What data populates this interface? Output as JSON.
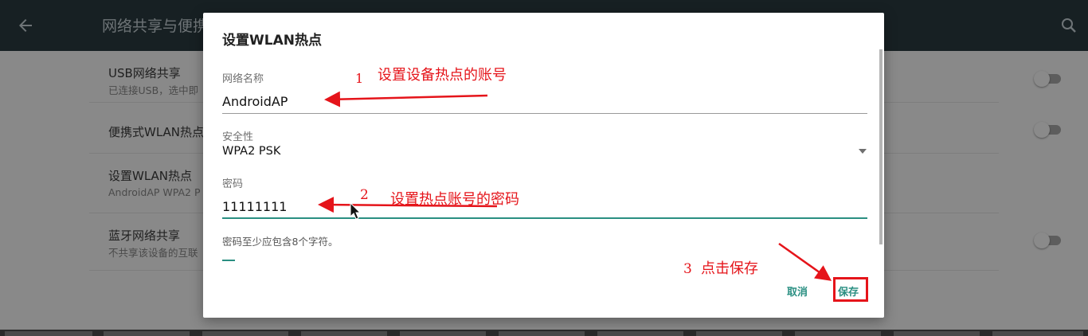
{
  "appbar": {
    "title": "网络共享与便携",
    "back_icon": "arrow-left-icon",
    "search_icon": "search-icon"
  },
  "settings": {
    "items": [
      {
        "title": "USB网络共享",
        "subtitle": "已连接USB，选中即"
      },
      {
        "title": "便携式WLAN热点",
        "subtitle": ""
      },
      {
        "title": "设置WLAN热点",
        "subtitle": "AndroidAP WPA2 P"
      },
      {
        "title": "蓝牙网络共享",
        "subtitle": "不共享该设备的互联"
      }
    ]
  },
  "dialog": {
    "title": "设置WLAN热点",
    "network_name_label": "网络名称",
    "network_name_value": "AndroidAP",
    "security_label": "安全性",
    "security_value": "WPA2 PSK",
    "password_label": "密码",
    "password_value": "11111111",
    "password_hint": "密码至少应包含8个字符。",
    "cancel_label": "取消",
    "save_label": "保存"
  },
  "annotations": {
    "n1": "1",
    "t1": "设置设备热点的账号",
    "n2": "2",
    "t2": "设置热点账号的密码",
    "n3": "3",
    "t3": "点击保存",
    "color": "#e5141a"
  },
  "colors": {
    "accent": "#2a8f82",
    "appbar": "#172023",
    "scrim": "#8d8d8d"
  }
}
